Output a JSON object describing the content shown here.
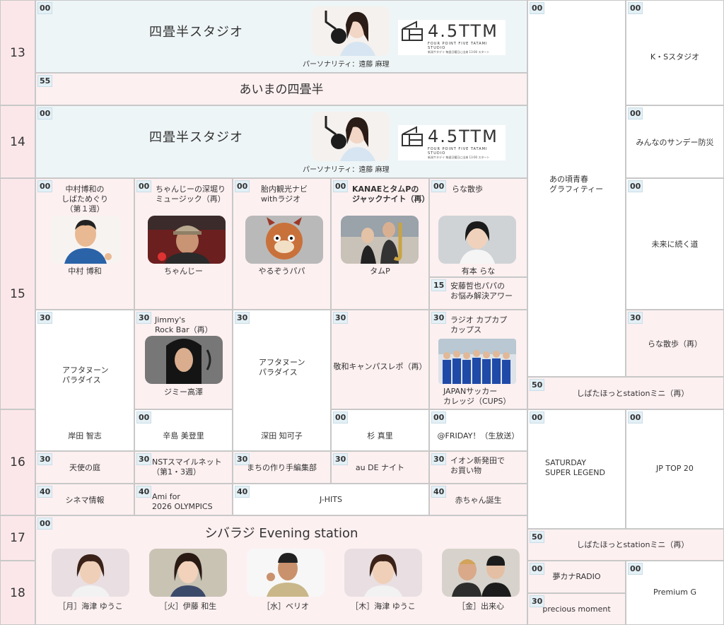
{
  "hours": [
    "13",
    "14",
    "15",
    "16",
    "17",
    "18"
  ],
  "shijo": {
    "title": "四畳半スタジオ",
    "personality": "パーソナリティ：遠藤 麻理",
    "logo_text": "4.5TTM",
    "logo_sub": "FOUR POINT FIVE TATAMI STUDIO",
    "logo_small": "新潟サタデイ 毎週日曜日に出来 13:00 スタート"
  },
  "aimano": "あいまの四畳半",
  "col_a": {
    "time_a": "00",
    "title_a": "あの頃青春\nグラフィティー"
  },
  "col_b": [
    {
      "time": "00",
      "title": "K・Sスタジオ"
    },
    {
      "time": "00",
      "title": "みんなのサンデー防災"
    },
    {
      "time": "00",
      "title": "未来に続く道"
    },
    {
      "time": "30",
      "title": "らな散歩（再）"
    }
  ],
  "shibata_mini": {
    "time": "50",
    "title": "しばたほっとstationミニ（再）"
  },
  "saturday": {
    "time": "00",
    "title": "SATURDAY\nSUPER LEGEND"
  },
  "jp": {
    "time": "00",
    "title": "JP TOP 20"
  },
  "shibata_mini2": {
    "time": "50",
    "title": "しばたほっとstationミニ（再）"
  },
  "yume": {
    "time": "00",
    "title": "夢カナRADIO"
  },
  "precious": {
    "time": "30",
    "title": "precious moment"
  },
  "premium": {
    "time": "00",
    "title": "Premium G"
  },
  "row15": [
    {
      "time": "00",
      "title": "中村博和の\nしばためぐり\n（第１週）",
      "person": "中村 博和"
    },
    {
      "time": "00",
      "title": "ちゃんじーの深堀り\nミュージック（再）",
      "person": "ちゃんじー"
    },
    {
      "time": "00",
      "title": "胎内観光ナビ\nwithラジオ",
      "person": "やるぞうパパ"
    },
    {
      "time": "00",
      "title": "KANAEとタムPの\nジャックナイト（再）",
      "person": "タムP"
    },
    {
      "time": "00",
      "title": "らな散歩",
      "person": "有本 らな"
    }
  ],
  "ando": {
    "time": "15",
    "title": "安藤哲也パパの\nお悩み解決アワー"
  },
  "row1530": [
    {
      "time": "30",
      "title": "アフタヌーン\nパラダイス"
    },
    {
      "time": "30",
      "title": "Jimmy's\nRock Bar（再）",
      "person": "ジミー高澤"
    },
    {
      "time": "30",
      "title": "アフタヌーン\nパラダイス"
    },
    {
      "time": "30",
      "title": "敬和キャンパスレポ（再）"
    },
    {
      "time": "30",
      "title": "ラジオ カプカプ\nカップス",
      "person": "JAPANサッカー\nカレッジ（CUPS）"
    }
  ],
  "row16": [
    {
      "time": "",
      "person": "岸田 智志"
    },
    {
      "time": "00",
      "person": "辛島 美登里"
    },
    {
      "time": "",
      "person": "深田 知可子"
    },
    {
      "time": "00",
      "person": "杉 真里"
    },
    {
      "time": "00",
      "title": "@FRIDAY！（生放送）"
    }
  ],
  "row1630": [
    {
      "time": "30",
      "title": "天使の庭"
    },
    {
      "time": "30",
      "title": "NSTスマイルネット\n（第1・3週）"
    },
    {
      "time": "30",
      "title": "まちの作り手編集部"
    },
    {
      "time": "30",
      "title": "au DE ナイト"
    },
    {
      "time": "30",
      "title": "イオン新発田で\nお買い物"
    }
  ],
  "row1640": [
    {
      "time": "40",
      "title": "シネマ情報"
    },
    {
      "time": "40",
      "title": "Ami for\n2026 OLYMPICS"
    },
    {
      "time": "40",
      "title": "J-HITS"
    },
    {
      "time": "40",
      "title": "赤ちゃん誕生"
    }
  ],
  "evening": {
    "time": "00",
    "title": "シバラジ Evening station",
    "hosts": [
      "［月］海津 ゆうこ",
      "［火］伊藤 和生",
      "［水］ベリオ",
      "［木］海津 ゆうこ",
      "［金］出来心"
    ]
  },
  "tag00": "00",
  "tag55": "55"
}
